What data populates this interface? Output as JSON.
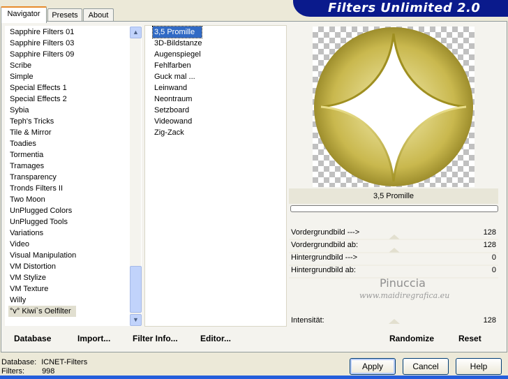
{
  "tabs": [
    {
      "label": "Navigator"
    },
    {
      "label": "Presets"
    },
    {
      "label": "About"
    }
  ],
  "app_title": "Filters Unlimited 2.0",
  "categories": [
    "Sapphire Filters 01",
    "Sapphire Filters 03",
    "Sapphire Filters 09",
    "Scribe",
    "Simple",
    "Special Effects 1",
    "Special Effects 2",
    "Sybia",
    "Teph's Tricks",
    "Tile & Mirror",
    "Toadies",
    "Tormentia",
    "Tramages",
    "Transparency",
    "Tronds Filters II",
    "Two Moon",
    "UnPlugged Colors",
    "UnPlugged Tools",
    "Variations",
    "Video",
    "Visual Manipulation",
    "VM Distortion",
    "VM Stylize",
    "VM Texture",
    "Willy",
    "°v° Kiwi`s Oelfilter"
  ],
  "filters": [
    "3,5 Promille",
    "3D-Bildstanze",
    "Augenspiegel",
    "Fehlfarben",
    "Guck mal ...",
    "Leinwand",
    "Neontraum",
    "Setzboard",
    "Videowand",
    "Zig-Zack"
  ],
  "selected_filter_name": "3,5 Promille",
  "params": [
    {
      "label": "Vordergrundbild --->",
      "value": "128"
    },
    {
      "label": "Vordergrundbild ab:",
      "value": "128"
    },
    {
      "label": "Hintergrundbild --->",
      "value": "0"
    },
    {
      "label": "Hintergrundbild ab:",
      "value": "0"
    }
  ],
  "intensity": {
    "label": "Intensität:",
    "value": "128"
  },
  "watermark": {
    "name": "Pinuccia",
    "url": "www.maidiregrafica.eu"
  },
  "bottom_buttons": {
    "database": "Database",
    "import": "Import...",
    "filter_info": "Filter Info...",
    "editor": "Editor...",
    "randomize": "Randomize",
    "reset": "Reset"
  },
  "dialog_buttons": {
    "apply": "Apply",
    "cancel": "Cancel",
    "help": "Help"
  },
  "status": {
    "database_label": "Database:",
    "database_value": "ICNET-Filters",
    "filters_label": "Filters:",
    "filters_value": "998"
  },
  "colors": {
    "selection": "#316ac5",
    "banner": "#0a1a8c",
    "tab_highlight": "#e68b2c"
  }
}
